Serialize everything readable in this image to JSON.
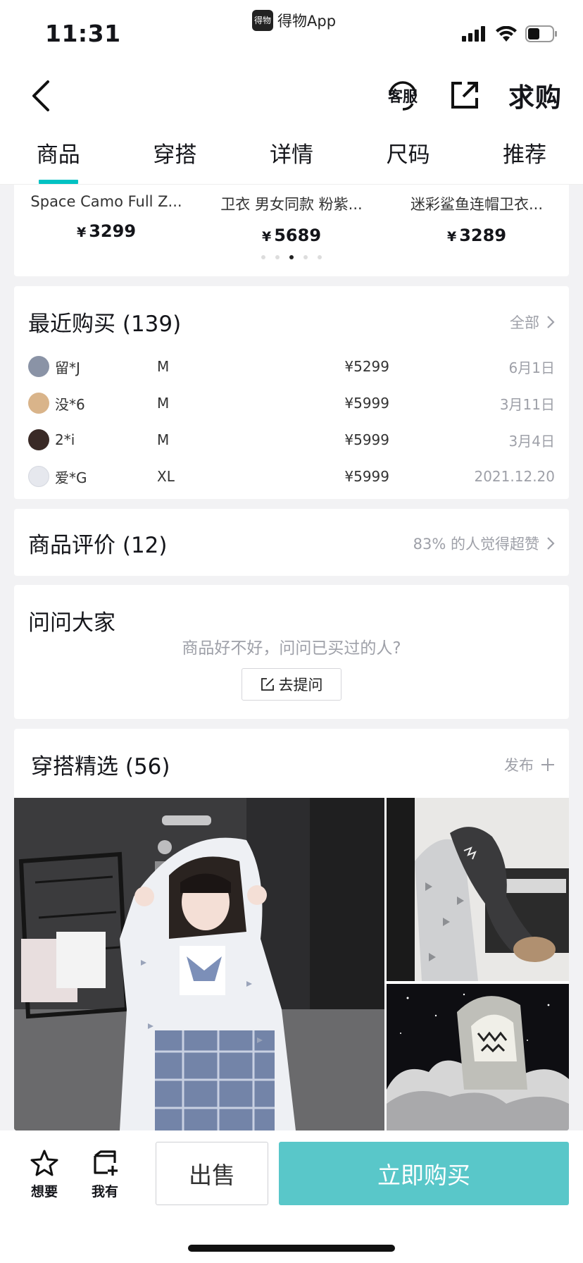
{
  "status": {
    "time": "11:31",
    "source_app": "得物App",
    "source_app_icon_text": "得物"
  },
  "header": {
    "back_icon": "chevron-left-icon",
    "service_label": "客服",
    "share_icon": "share-out-icon",
    "qiugou_label": "求购"
  },
  "tabs": [
    {
      "label": "商品",
      "active": true
    },
    {
      "label": "穿搭",
      "active": false
    },
    {
      "label": "详情",
      "active": false
    },
    {
      "label": "尺码",
      "active": false
    },
    {
      "label": "推荐",
      "active": false
    }
  ],
  "recommended": {
    "items": [
      {
        "name": "Space Camo Full Z...",
        "price": "3299"
      },
      {
        "name": "卫衣 男女同款 粉紫...",
        "price": "5689"
      },
      {
        "name": "迷彩鲨鱼连帽卫衣...",
        "price": "3289"
      }
    ],
    "currency": "¥",
    "page_count": 5,
    "active_page": 3
  },
  "recent_purchases": {
    "title": "最近购买 (139)",
    "link_label": "全部",
    "rows": [
      {
        "buyer": "留*J",
        "size": "M",
        "price": "¥5299",
        "date": "6月1日",
        "avatar_color": "#8a93a6"
      },
      {
        "buyer": "没*6",
        "size": "M",
        "price": "¥5999",
        "date": "3月11日",
        "avatar_color": "#d9b48a"
      },
      {
        "buyer": "2*i",
        "size": "M",
        "price": "¥5999",
        "date": "3月4日",
        "avatar_color": "#3a2a26"
      },
      {
        "buyer": "爱*G",
        "size": "XL",
        "price": "¥5999",
        "date": "2021.12.20",
        "avatar_color": "#e6e8ee"
      }
    ]
  },
  "reviews": {
    "title": "商品评价 (12)",
    "summary": "83% 的人觉得超赞"
  },
  "ask": {
    "title": "问问大家",
    "hint": "商品好不好，问问已买过的人?",
    "button_label": "去提问"
  },
  "outfits": {
    "title": "穿搭精选 (56)",
    "publish_label": "发布"
  },
  "bottom_bar": {
    "want_label": "想要",
    "own_label": "我有",
    "sell_label": "出售",
    "buy_label": "立即购买"
  },
  "colors": {
    "accent": "#01c2c3",
    "buy_button": "#59c7c9",
    "muted_text": "#9ea0a8"
  }
}
